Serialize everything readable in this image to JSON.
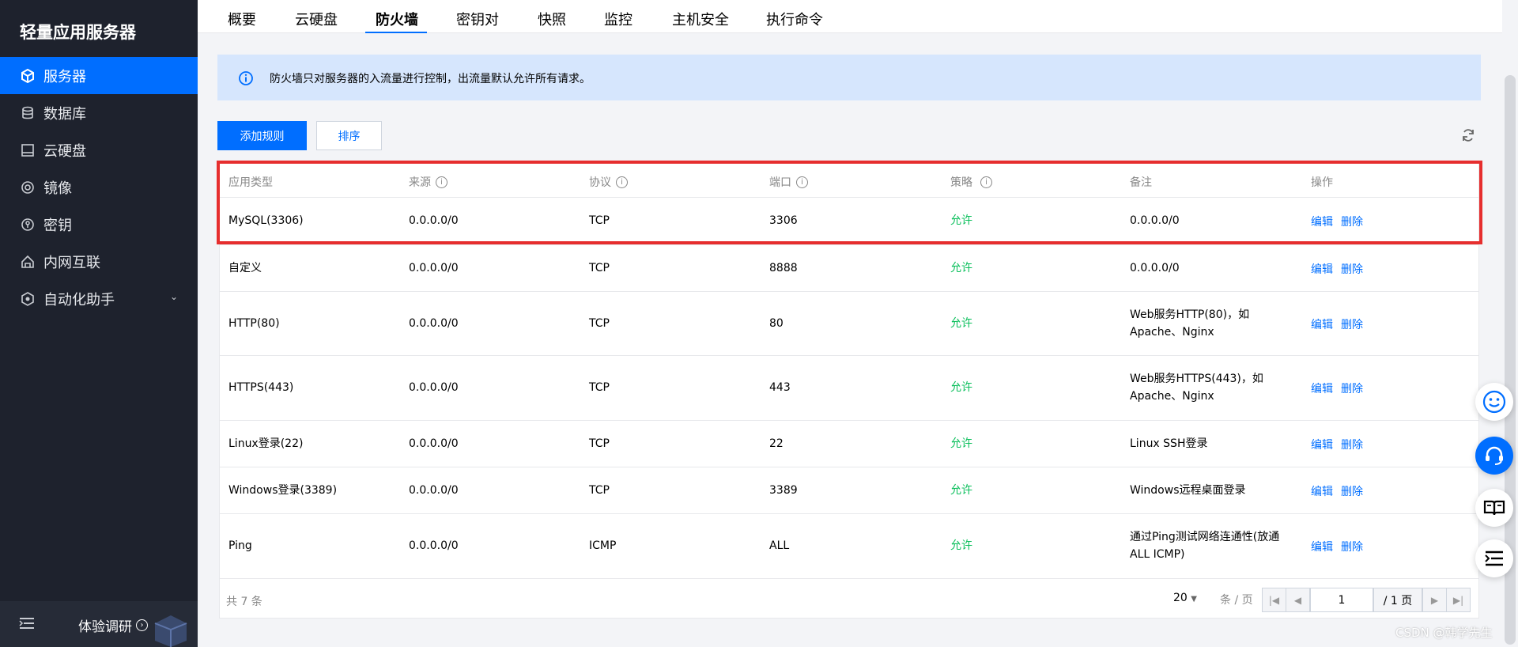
{
  "sidebar": {
    "brand": "轻量应用服务器",
    "items": [
      {
        "label": "服务器",
        "icon": "server-icon"
      },
      {
        "label": "数据库",
        "icon": "database-icon"
      },
      {
        "label": "云硬盘",
        "icon": "disk-icon"
      },
      {
        "label": "镜像",
        "icon": "image-icon"
      },
      {
        "label": "密钥",
        "icon": "key-icon"
      },
      {
        "label": "内网互联",
        "icon": "network-icon"
      },
      {
        "label": "自动化助手",
        "icon": "automation-icon"
      }
    ],
    "survey_label": "体验调研"
  },
  "tabs": [
    "概要",
    "云硬盘",
    "防火墙",
    "密钥对",
    "快照",
    "监控",
    "主机安全",
    "执行命令"
  ],
  "active_tab": "防火墙",
  "alert": {
    "text": "防火墙只对服务器的入流量进行控制，出流量默认允许所有请求。"
  },
  "toolbar": {
    "add_rule": "添加规则",
    "sort": "排序"
  },
  "table": {
    "headers": [
      "应用类型",
      "来源",
      "协议",
      "端口",
      "策略",
      "备注",
      "操作"
    ],
    "rows": [
      {
        "app": "MySQL(3306)",
        "source": "0.0.0.0/0",
        "protocol": "TCP",
        "port": "3306",
        "policy": "允许",
        "note1": "0.0.0.0/0",
        "note2": ""
      },
      {
        "app": "自定义",
        "source": "0.0.0.0/0",
        "protocol": "TCP",
        "port": "8888",
        "policy": "允许",
        "note1": "0.0.0.0/0",
        "note2": ""
      },
      {
        "app": "HTTP(80)",
        "source": "0.0.0.0/0",
        "protocol": "TCP",
        "port": "80",
        "policy": "允许",
        "note1": "Web服务HTTP(80)，如",
        "note2": "Apache、Nginx"
      },
      {
        "app": "HTTPS(443)",
        "source": "0.0.0.0/0",
        "protocol": "TCP",
        "port": "443",
        "policy": "允许",
        "note1": "Web服务HTTPS(443)，如",
        "note2": "Apache、Nginx"
      },
      {
        "app": "Linux登录(22)",
        "source": "0.0.0.0/0",
        "protocol": "TCP",
        "port": "22",
        "policy": "允许",
        "note1": "Linux SSH登录",
        "note2": ""
      },
      {
        "app": "Windows登录(3389)",
        "source": "0.0.0.0/0",
        "protocol": "TCP",
        "port": "3389",
        "policy": "允许",
        "note1": "Windows远程桌面登录",
        "note2": ""
      },
      {
        "app": "Ping",
        "source": "0.0.0.0/0",
        "protocol": "ICMP",
        "port": "ALL",
        "policy": "允许",
        "note1": "通过Ping测试网络连通性(放通",
        "note2": "ALL ICMP)"
      }
    ],
    "op_edit": "编辑",
    "op_delete": "删除"
  },
  "pager": {
    "total": "共 7 条",
    "page_size": "20",
    "page_unit": "条 / 页",
    "current_page": "1",
    "total_pages": "/ 1 页"
  },
  "watermark": "CSDN @韩学先生",
  "colors": {
    "primary": "#006eff",
    "allow": "#0abf5b",
    "highlight": "#e62e2e",
    "sidebar_bg": "#1e222d"
  }
}
